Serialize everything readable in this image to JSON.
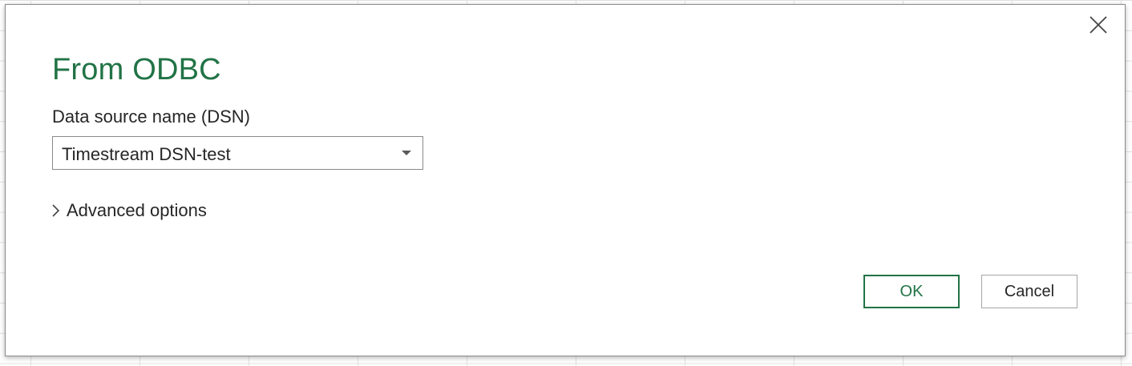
{
  "dialog": {
    "title": "From ODBC",
    "dsn_label": "Data source name (DSN)",
    "dsn_selected": "Timestream DSN-test",
    "advanced_label": "Advanced options",
    "ok_label": "OK",
    "cancel_label": "Cancel"
  },
  "icons": {
    "close": "close-icon",
    "dropdown": "chevron-down-icon",
    "expand": "chevron-right-icon"
  },
  "colors": {
    "accent": "#217346",
    "text": "#262626",
    "border": "#8a8a8a"
  }
}
